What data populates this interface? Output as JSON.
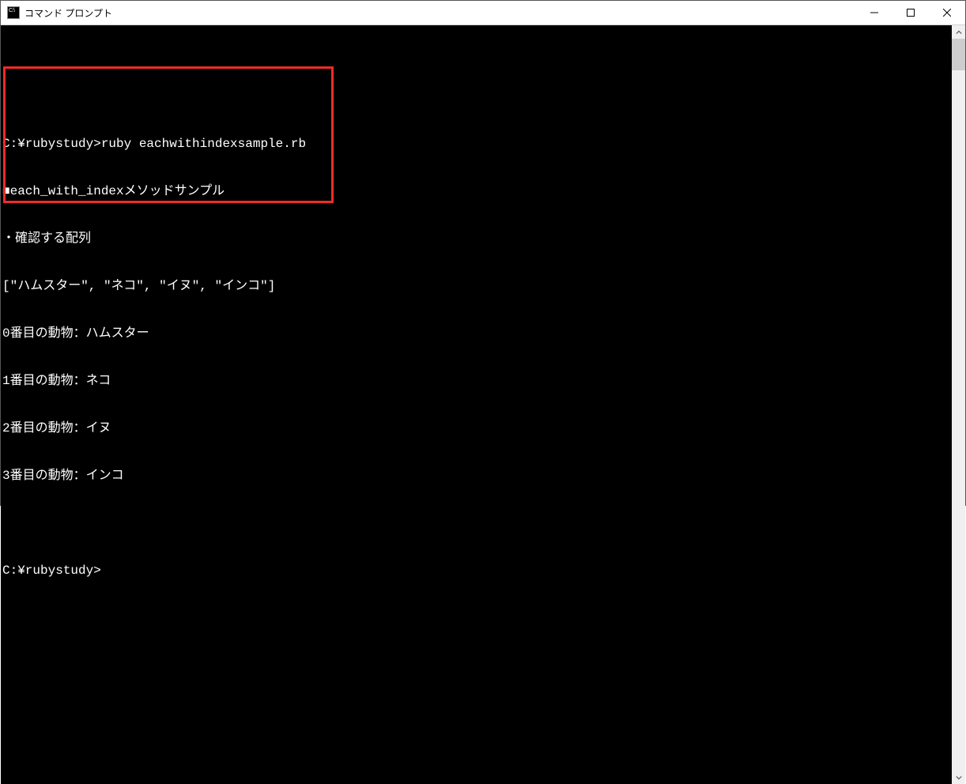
{
  "window": {
    "title": "コマンド プロンプト"
  },
  "terminal": {
    "lines": [
      "",
      "C:¥rubystudy>ruby eachwithindexsample.rb",
      "■each_with_indexメソッドサンプル",
      "・確認する配列",
      "[\"ハムスター\", \"ネコ\", \"イヌ\", \"インコ\"]",
      "0番目の動物：ハムスター",
      "1番目の動物：ネコ",
      "2番目の動物：イヌ",
      "3番目の動物：インコ",
      "",
      "C:¥rubystudy>",
      "",
      "",
      ""
    ]
  }
}
